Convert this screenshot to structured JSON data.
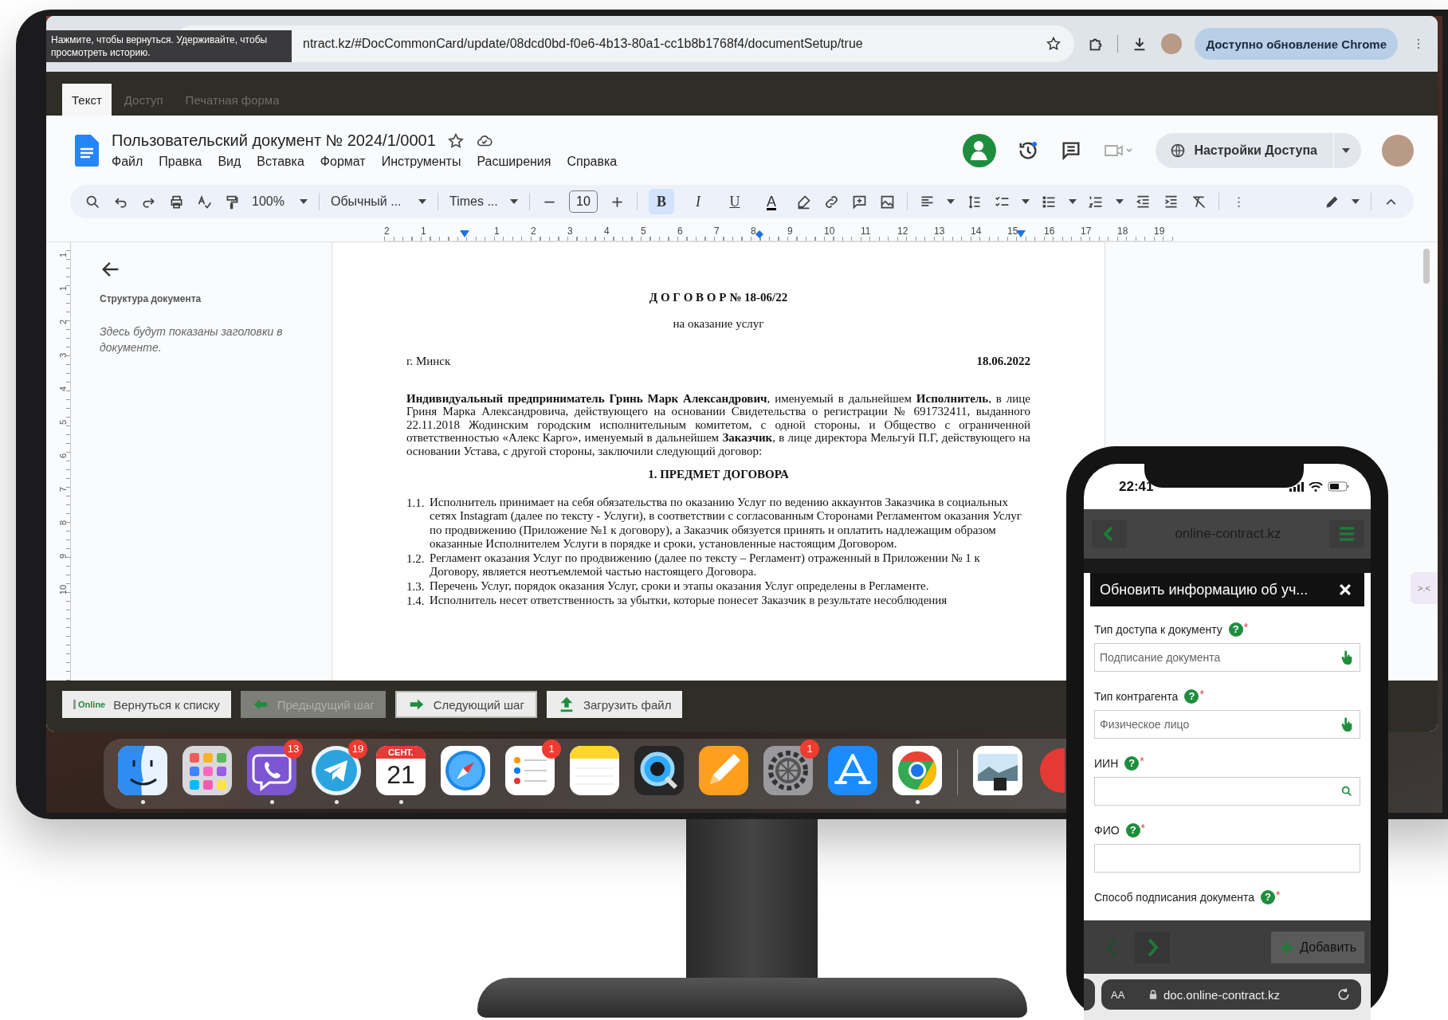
{
  "browser": {
    "tooltip": "Нажмите, чтобы вернуться. Удерживайте, чтобы просмотреть историю.",
    "address": "ntract.kz/#DocCommonCard/update/08dcd0bd-f0e6-4b13-80a1-cc1b8b1768f4/documentSetup/true",
    "update_button": "Доступно обновление Chrome"
  },
  "app_tabs": [
    {
      "label": "Текст",
      "selected": true
    },
    {
      "label": "Доступ",
      "selected": false
    },
    {
      "label": "Печатная форма",
      "selected": false
    }
  ],
  "docs": {
    "title": "Пользовательский документ № 2024/1/0001",
    "menu": [
      "Файл",
      "Правка",
      "Вид",
      "Вставка",
      "Формат",
      "Инструменты",
      "Расширения",
      "Справка"
    ],
    "share_button": "Настройки Доступа",
    "toolbar": {
      "zoom": "100%",
      "style": "Обычный ...",
      "font": "Times ...",
      "font_size": "10",
      "format_buttons": [
        {
          "glyph": "B",
          "kind": "bold",
          "selected": true
        },
        {
          "glyph": "I",
          "kind": "italic",
          "selected": false
        },
        {
          "glyph": "U",
          "kind": "underline",
          "selected": false
        },
        {
          "glyph": "A",
          "kind": "color",
          "selected": false
        }
      ]
    },
    "ruler": [
      "2",
      "1",
      "1",
      "2",
      "3",
      "4",
      "5",
      "6",
      "7",
      "8",
      "9",
      "10",
      "11",
      "12",
      "13",
      "14",
      "15",
      "16",
      "17",
      "18",
      "19"
    ],
    "side_ruler": [
      "1",
      "1",
      "2",
      "3",
      "4",
      "5",
      "6",
      "7",
      "8",
      "9",
      "10"
    ]
  },
  "outline": {
    "heading": "Структура документа",
    "hint": "Здесь будут показаны заголовки в документе."
  },
  "document": {
    "title": "Д О Г О В О Р № 18-06/22",
    "subtitle": "на оказание услуг",
    "city": "г. Минск",
    "date": "18.06.2022",
    "intro": "**Индивидуальный предприниматель Гринь Марк Александрович**, именуемый в дальнейшем **Исполнитель**, в лице Гриня Марка Александровича, действующего на основании Свидетельства о регистрации № 691732411, выданного 22.11.2018 Жодинским городским исполнительным комитетом, с одной стороны, и Общество с ограниченной ответственностью «Алекс Карго», именуемый в дальнейшем **Заказчик**, в лице директора Мельгуй П.Г, действующего на основании Устава, с другой стороны, заключили следующий договор:",
    "section": "1. ПРЕДМЕТ ДОГОВОРА",
    "items": [
      {
        "number": "1.1.",
        "text": "Исполнитель принимает на себя обязательства по оказанию Услуг по ведению аккаунтов Заказчика в социальных сетях Instagram (далее по тексту - Услуги), в соответствии с согласованным Сторонами Регламентом оказания Услуг по продвижению (Приложение №1 к договору), а Заказчик обязуется принять и оплатить надлежащим образом оказанные Исполнителем Услуги в порядке и сроки, установленные настоящим Договором."
      },
      {
        "number": "1.2.",
        "text": "Регламент оказания Услуг по продвижению (далее по тексту – Регламент) отраженный в Приложении № 1 к Договору, является неотъемлемой частью настоящего Договора."
      },
      {
        "number": "1.3.",
        "text": "Перечень Услуг, порядок оказания Услуг, сроки и этапы оказания Услуг определены в Регламенте."
      },
      {
        "number": "1.4.",
        "text": "Исполнитель несет ответственность за убытки, которые понесет Заказчик в результате несоблюдения"
      }
    ]
  },
  "bottom_buttons": [
    {
      "label": "Вернуться к списку",
      "kind": "back",
      "logo": "Online",
      "disabled": false
    },
    {
      "label": "Предыдущий шаг",
      "kind": "prev",
      "disabled": true
    },
    {
      "label": "Следующий шаг",
      "kind": "next",
      "disabled": false
    },
    {
      "label": "Загрузить файл",
      "kind": "upload",
      "disabled": false
    }
  ],
  "side_widget": ">.<",
  "dock": [
    {
      "kind": "finder",
      "running": true
    },
    {
      "kind": "launchpad",
      "running": false
    },
    {
      "kind": "viber",
      "badge": "13",
      "running": true
    },
    {
      "kind": "telegram",
      "badge": "19",
      "running": true
    },
    {
      "kind": "calendar",
      "month": "СЕНТ.",
      "day": "21",
      "running": true
    },
    {
      "kind": "safari",
      "running": false
    },
    {
      "kind": "reminders",
      "badge": "1",
      "running": false
    },
    {
      "kind": "notes",
      "running": false
    },
    {
      "kind": "quicktime",
      "running": false
    },
    {
      "kind": "pages",
      "running": false
    },
    {
      "kind": "settings",
      "badge": "1",
      "running": false
    },
    {
      "kind": "appstore",
      "running": false
    },
    {
      "kind": "chrome",
      "running": true
    },
    {
      "kind": "divider"
    },
    {
      "kind": "preview",
      "running": false
    },
    {
      "kind": "partial",
      "running": false
    }
  ],
  "phone": {
    "time": "22:41",
    "site": "online-contract.kz",
    "modal_title": "Обновить информацию об уч...",
    "fields": [
      {
        "label": "Тип доступа к документу",
        "help": "?",
        "mark": "*",
        "kind": "select",
        "value": "Подписание документа"
      },
      {
        "label": "Тип контрагента",
        "help": "?",
        "mark": "*",
        "kind": "select",
        "value": "Физическое лицо"
      },
      {
        "label": "ИИН",
        "help": "?",
        "mark": "*",
        "kind": "search"
      },
      {
        "label": "ФИО",
        "help": "?",
        "mark": "*",
        "kind": "text"
      },
      {
        "label": "Способ подписания документа",
        "help": "?",
        "mark": "*",
        "kind": "label"
      }
    ],
    "add_button": "Добавить",
    "text_size": "AA",
    "url": "doc.online-contract.kz"
  }
}
